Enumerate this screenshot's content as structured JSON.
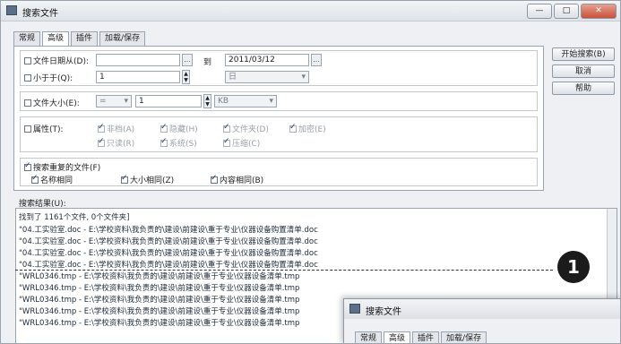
{
  "window": {
    "title": "搜索文件",
    "controls": {
      "minimize": "—",
      "maximize": "□",
      "close": "✕"
    }
  },
  "tabs": [
    {
      "label": "常规",
      "active": false
    },
    {
      "label": "高级",
      "active": true
    },
    {
      "label": "插件",
      "active": false
    },
    {
      "label": "加载/保存",
      "active": false
    }
  ],
  "date_section": {
    "file_date_label": "文件日期从(D):",
    "date_from": "",
    "to_label": "到",
    "date_to": "2011/03/12",
    "less_than_label": "小于于(Q):",
    "less_than_value": "1",
    "unit_value": "日"
  },
  "size_section": {
    "file_size_label": "文件大小(E):",
    "operator": "=",
    "size_value": "1",
    "unit": "KB"
  },
  "attr_section": {
    "attr_label": "属性(T):",
    "items": [
      {
        "label": "非档(A)"
      },
      {
        "label": "隐藏(H)"
      },
      {
        "label": "文件夹(D)"
      },
      {
        "label": "加密(E)"
      },
      {
        "label": "只读(R)"
      },
      {
        "label": "系统(S)"
      },
      {
        "label": "压缩(C)"
      }
    ]
  },
  "dup_section": {
    "find_dups_label": "搜索重复的文件(F)",
    "same_name_label": "名称相同",
    "same_size_label": "大小相同(Z)",
    "same_content_label": "内容相同(B)"
  },
  "right_buttons": {
    "start": "开始搜索(B)",
    "cancel": "取消",
    "help": "帮助"
  },
  "results": {
    "label": "搜索结果(U):",
    "summary": "找到了 1161个文件, 0个文件夹]",
    "lines": [
      "\"04.工实验室.doc - E:\\学校资料\\我负责的\\建设\\前建设\\重于专业\\仪器设备购置清单.doc",
      "\"04.工实验室.doc - E:\\学校资料\\我负责的\\建设\\前建设\\重于专业\\仪器设备购置清单.doc",
      "\"04.工实验室.doc - E:\\学校资料\\我负责的\\建设\\前建设\\重于专业\\仪器设备购置清单.doc",
      "\"04.工实验室.doc - E:\\学校资料\\我负责的\\建设\\前建设\\重于专业\\仪器设备购置清单.doc",
      "\"WRL0346.tmp - E:\\学校资料\\我负责的\\建设\\前建设\\重于专业\\仪器设备清单.tmp",
      "\"WRL0346.tmp - E:\\学校资料\\我负责的\\建设\\前建设\\重于专业\\仪器设备清单.tmp",
      "\"WRL0346.tmp - E:\\学校资料\\我负责的\\建设\\前建设\\重于专业\\仪器设备清单.tmp",
      "\"WRL0346.tmp - E:\\学校资料\\我负责的\\建设\\前建设\\重于专业\\仪器设备清单.tmp",
      "\"WRL0346.tmp - E:\\学校资料\\我负责的\\建设\\前建设\\重于专业\\仪器设备清单.tmp"
    ]
  },
  "marker": "1",
  "window2": {
    "title": "搜索文件",
    "tabs": [
      {
        "label": "常规"
      },
      {
        "label": "高级"
      },
      {
        "label": "插件"
      },
      {
        "label": "加载/保存"
      }
    ]
  }
}
